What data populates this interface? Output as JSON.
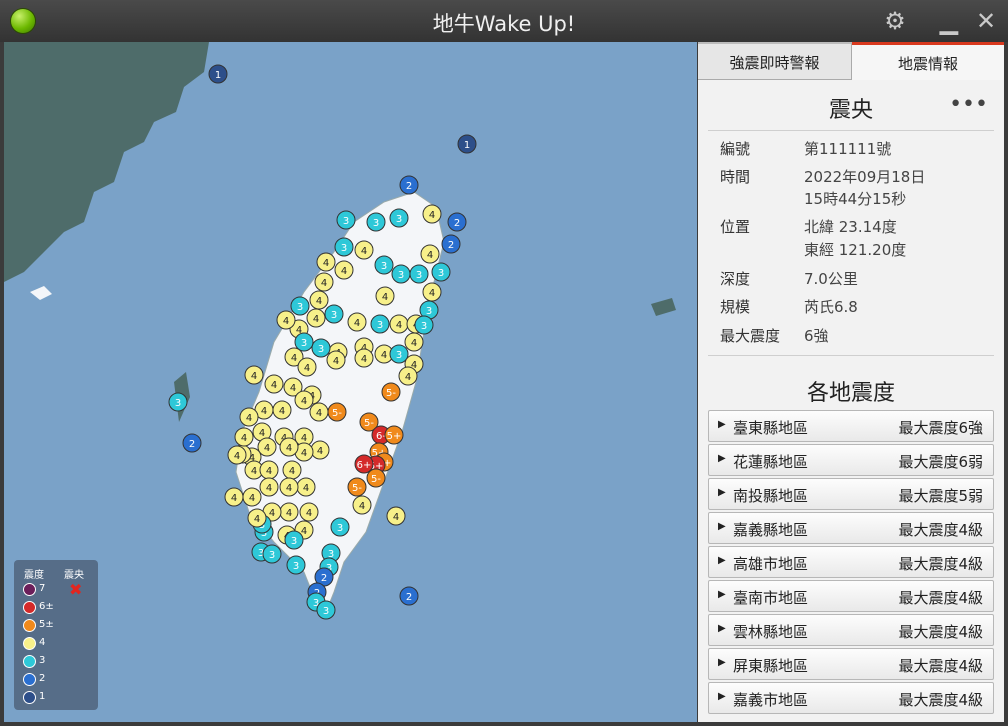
{
  "window": {
    "title": "地牛Wake Up!"
  },
  "tabs": [
    {
      "label": "強震即時警報"
    },
    {
      "label": "地震情報"
    }
  ],
  "epicenter": {
    "heading": "震央",
    "more": "•••",
    "rows": [
      {
        "key": "編號",
        "value": "第111111號"
      },
      {
        "key": "時間",
        "value": "2022年09月18日",
        "value2": "15時44分15秒"
      },
      {
        "key": "位置",
        "value": "北緯 23.14度",
        "value2": "東經 121.20度"
      },
      {
        "key": "深度",
        "value": "7.0公里"
      },
      {
        "key": "規模",
        "value": "芮氏6.8"
      },
      {
        "key": "最大震度",
        "value": "6強"
      }
    ]
  },
  "local": {
    "heading": "各地震度",
    "regions": [
      {
        "name": "臺東縣地區",
        "max": "最大震度6強"
      },
      {
        "name": "花蓮縣地區",
        "max": "最大震度6弱"
      },
      {
        "name": "南投縣地區",
        "max": "最大震度5弱"
      },
      {
        "name": "嘉義縣地區",
        "max": "最大震度4級"
      },
      {
        "name": "高雄市地區",
        "max": "最大震度4級"
      },
      {
        "name": "臺南市地區",
        "max": "最大震度4級"
      },
      {
        "name": "雲林縣地區",
        "max": "最大震度4級"
      },
      {
        "name": "屏東縣地區",
        "max": "最大震度4級"
      },
      {
        "name": "嘉義市地區",
        "max": "最大震度4級"
      }
    ]
  },
  "legend": {
    "intensity_label": "震度",
    "epicenter_label": "震央",
    "levels": [
      {
        "label": "7",
        "color": "#6b1f5a"
      },
      {
        "label": "6±",
        "color": "#d42a2a"
      },
      {
        "label": "5±",
        "color": "#f08a1c"
      },
      {
        "label": "4",
        "color": "#f7f08a"
      },
      {
        "label": "3",
        "color": "#2ec8d8"
      },
      {
        "label": "2",
        "color": "#2a6fd0"
      },
      {
        "label": "1",
        "color": "#2d4f8a"
      }
    ]
  },
  "markers_note": "",
  "map_colors": {
    "sea": "#7aa2c8",
    "land": "#4e6c6a",
    "taiwan": "#f4f6f9"
  }
}
